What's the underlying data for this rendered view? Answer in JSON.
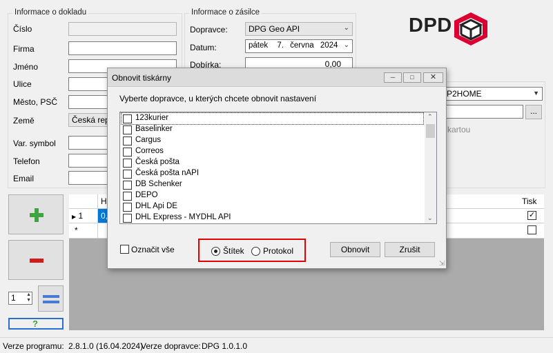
{
  "doc_info": {
    "title": "Informace o dokladu",
    "fields": [
      {
        "label": "Číslo",
        "value": ""
      },
      {
        "label": "Firma",
        "value": ""
      },
      {
        "label": "Jméno",
        "value": ""
      },
      {
        "label": "Ulice",
        "value": ""
      },
      {
        "label": "Město, PSČ",
        "value": ""
      },
      {
        "label": "Země",
        "value": "Česká repu"
      },
      {
        "label": "Var. symbol",
        "value": ""
      },
      {
        "label": "Telefon",
        "value": ""
      },
      {
        "label": "Email",
        "value": ""
      }
    ]
  },
  "shipment_info": {
    "title": "Informace o zásilce",
    "carrier_label": "Dopravce:",
    "carrier_value": "DPG Geo API",
    "date_label": "Datum:",
    "date_day": "pátek",
    "date_date": "7.",
    "date_month": "června",
    "date_year": "2024",
    "cod_label": "Dobírka:",
    "cod_value": "0,00"
  },
  "right_panel": {
    "service_value": "P2HOME",
    "card_text": "kartou",
    "browse_label": "..."
  },
  "logo": {
    "text": "DPD",
    "color": "#dc0032"
  },
  "grid": {
    "col_h": "H",
    "col_print": "Tisk",
    "row1_index": "1",
    "row1_value": "0,",
    "row1_print_checked": true,
    "new_row_marker": "*"
  },
  "left_buttons": {
    "add_icon": "plus-icon",
    "remove_icon": "minus-icon",
    "count_value": "1",
    "help_label": "?"
  },
  "dialog": {
    "title": "Obnovit tiskárny",
    "instruction": "Vyberte dopravce, u kterých chcete obnovit nastavení",
    "carriers": [
      "123kurier",
      "Baselinker",
      "Cargus",
      "Correos",
      "Česká pošta",
      "Česká pošta nAPI",
      "DB Schenker",
      "DEPO",
      "DHL Api DE",
      "DHL Express - MYDHL API"
    ],
    "select_all_label": "Označit vše",
    "radio_label_label": "Štítek",
    "radio_protocol_label": "Protokol",
    "selected_radio": "Štítek",
    "refresh_button": "Obnovit",
    "cancel_button": "Zrušit",
    "highlight_color": "#e00000"
  },
  "status_bar": {
    "program_version_label": "Verze programu:",
    "program_version": "2.8.1.0 (16.04.2024)",
    "carrier_version_label": "Verze dopravce:",
    "carrier_version": "DPG 1.0.1.0"
  }
}
